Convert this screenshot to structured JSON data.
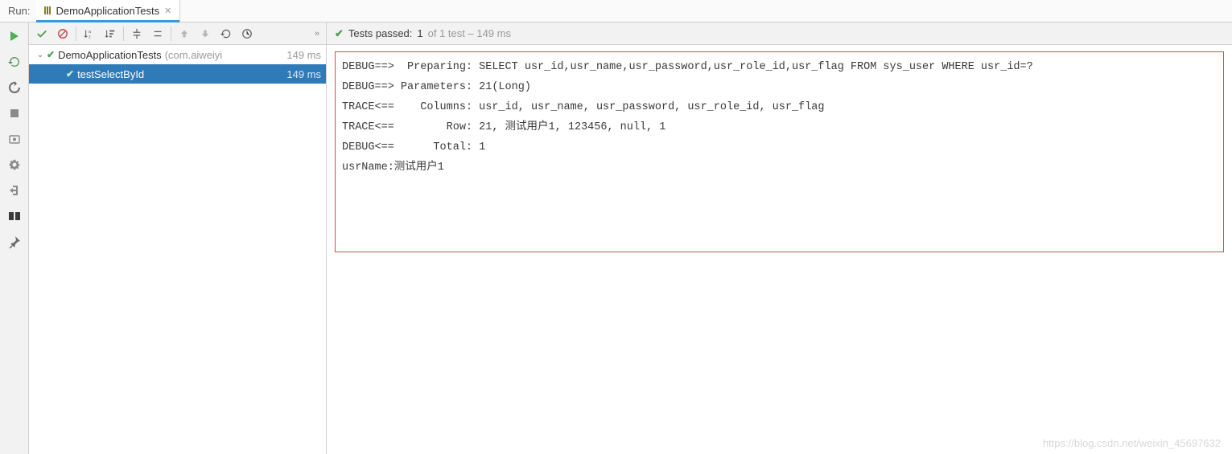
{
  "tabbar": {
    "run_label": "Run:",
    "tab_title": "DemoApplicationTests"
  },
  "tree": {
    "root": {
      "name": "DemoApplicationTests",
      "meta": "(com.aiweiyi",
      "time": "149 ms"
    },
    "child": {
      "name": "testSelectById",
      "time": "149 ms"
    }
  },
  "status": {
    "prefix": "Tests passed:",
    "passed": "1",
    "suffix": "of 1 test – 149 ms"
  },
  "console": {
    "text": "DEBUG==>  Preparing: SELECT usr_id,usr_name,usr_password,usr_role_id,usr_flag FROM sys_user WHERE usr_id=?\nDEBUG==> Parameters: 21(Long)\nTRACE<==    Columns: usr_id, usr_name, usr_password, usr_role_id, usr_flag\nTRACE<==        Row: 21, 测试用户1, 123456, null, 1\nDEBUG<==      Total: 1\nusrName:测试用户1"
  },
  "watermark": "https://blog.csdn.net/weixin_45697632"
}
